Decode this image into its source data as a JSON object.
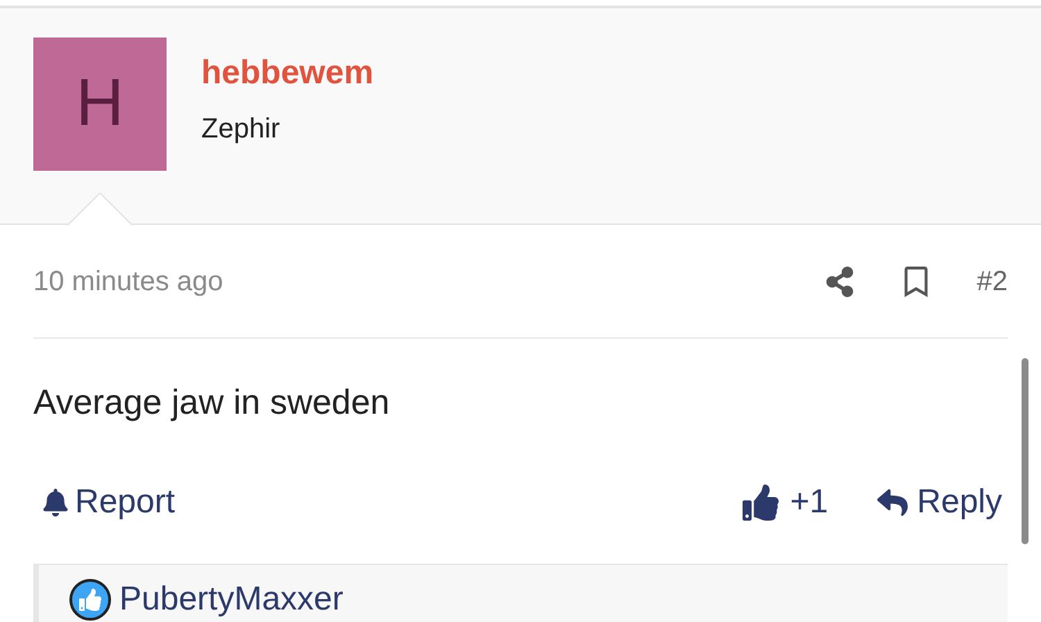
{
  "post_header": {
    "avatar_letter": "H",
    "username": "hebbewem",
    "user_title": "Zephir"
  },
  "post_meta": {
    "time": "10 minutes ago",
    "number": "#2"
  },
  "post_body": "Average jaw in sweden",
  "actions": {
    "report": "Report",
    "reactions": "+1",
    "reply": "Reply"
  },
  "quote": {
    "author": "PubertyMaxxer"
  }
}
